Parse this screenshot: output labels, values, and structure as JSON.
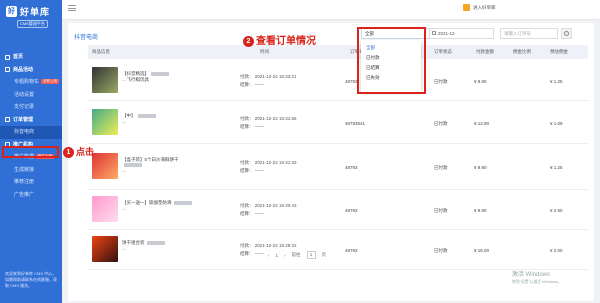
{
  "brand": {
    "title": "好单库",
    "subtitle": "CMS管理平台",
    "logo": "好"
  },
  "nav": {
    "home": "首页",
    "activity_group": "商品活动",
    "special_cart": "专题购物车",
    "special_badge": "全新上线",
    "activity_manage": "活动设置",
    "payment_record": "支付记录",
    "orders_group": "订单管理",
    "douyin_orders": "抖音电商",
    "promo_group": "推广机构",
    "agency_data": "推广数据",
    "agency_badge": "推广上线",
    "generate_link": "生成链接",
    "partner_register": "推荐注册",
    "ad_push": "广告推广",
    "footer_note": "欢迎来到好单库 CMS 中心，如需帮助请联系在线客服，获取 CMS 服务。"
  },
  "topbar": {
    "user": "进入好单库"
  },
  "page": {
    "title": "抖音电商"
  },
  "filters": {
    "status_value": "全部",
    "status_options": [
      "全部",
      "已付款",
      "已结算",
      "已失效"
    ],
    "month": "2021-12",
    "search_placeholder": "请输入订单号"
  },
  "table": {
    "headers": [
      "商品信息",
      "时间",
      "订单号",
      "订单状态",
      "付款金额",
      "佣金比例",
      "预估佣金"
    ],
    "rows": [
      {
        "name": "【抖音精选】",
        "name_tail": "…飞行棋玩具",
        "paid": "付款：",
        "paid_time": "2021-12-22 15:33:21",
        "settle": "结算：",
        "settle_time": "——",
        "order": "48793",
        "status": "已付款",
        "amount": "¥ 9.90",
        "rate": "",
        "commission": "¥ 1.25"
      },
      {
        "name": "【中】",
        "name_tail": "…",
        "paid": "付款：",
        "paid_time": "2021-12-22 15:31:56",
        "settle": "结算：",
        "settle_time": "——",
        "order": "48793541",
        "status": "已付款",
        "amount": "¥ 12.90",
        "rate": "",
        "commission": "¥ 1.09"
      },
      {
        "name": "【盒子装】5个白沙海鲜饼干",
        "name_tail": "…",
        "paid": "付款：",
        "paid_time": "2021-12-22 15:31:33",
        "settle": "结算：",
        "settle_time": "——",
        "order": "48793",
        "status": "已付款",
        "amount": "¥ 9.90",
        "rate": "",
        "commission": "¥ 1.25"
      },
      {
        "name": "【买一送一】瑜伽垫防滑",
        "name_tail": "…",
        "paid": "付款：",
        "paid_time": "2021-12-22 15:30:43",
        "settle": "结算：",
        "settle_time": "——",
        "order": "48793",
        "status": "已付款",
        "amount": "¥ 9.90",
        "rate": "",
        "commission": "¥ 2.50"
      },
      {
        "name": "饼干组合装",
        "name_tail": "…",
        "paid": "付款：",
        "paid_time": "2021-12-22 15:29:22",
        "settle": "结算：",
        "settle_time": "——",
        "order": "48793",
        "status": "已付款",
        "amount": "¥ 15.00",
        "rate": "",
        "commission": "¥ 2.00"
      }
    ]
  },
  "pager": {
    "prev": "‹",
    "page": "1",
    "next": "›",
    "goto": "前往",
    "page_unit": "页"
  },
  "annotations": {
    "click_num": "1",
    "click_text": "点击",
    "view_num": "2",
    "view_text": "查看订单情况"
  },
  "watermark": {
    "line1": "激活 Windows",
    "line2": "转到“设置”以激活 Windows。"
  },
  "colors": {
    "sidebar": "#2f6fd6",
    "accent": "#2f6fd6",
    "annotation": "#d9231b"
  }
}
